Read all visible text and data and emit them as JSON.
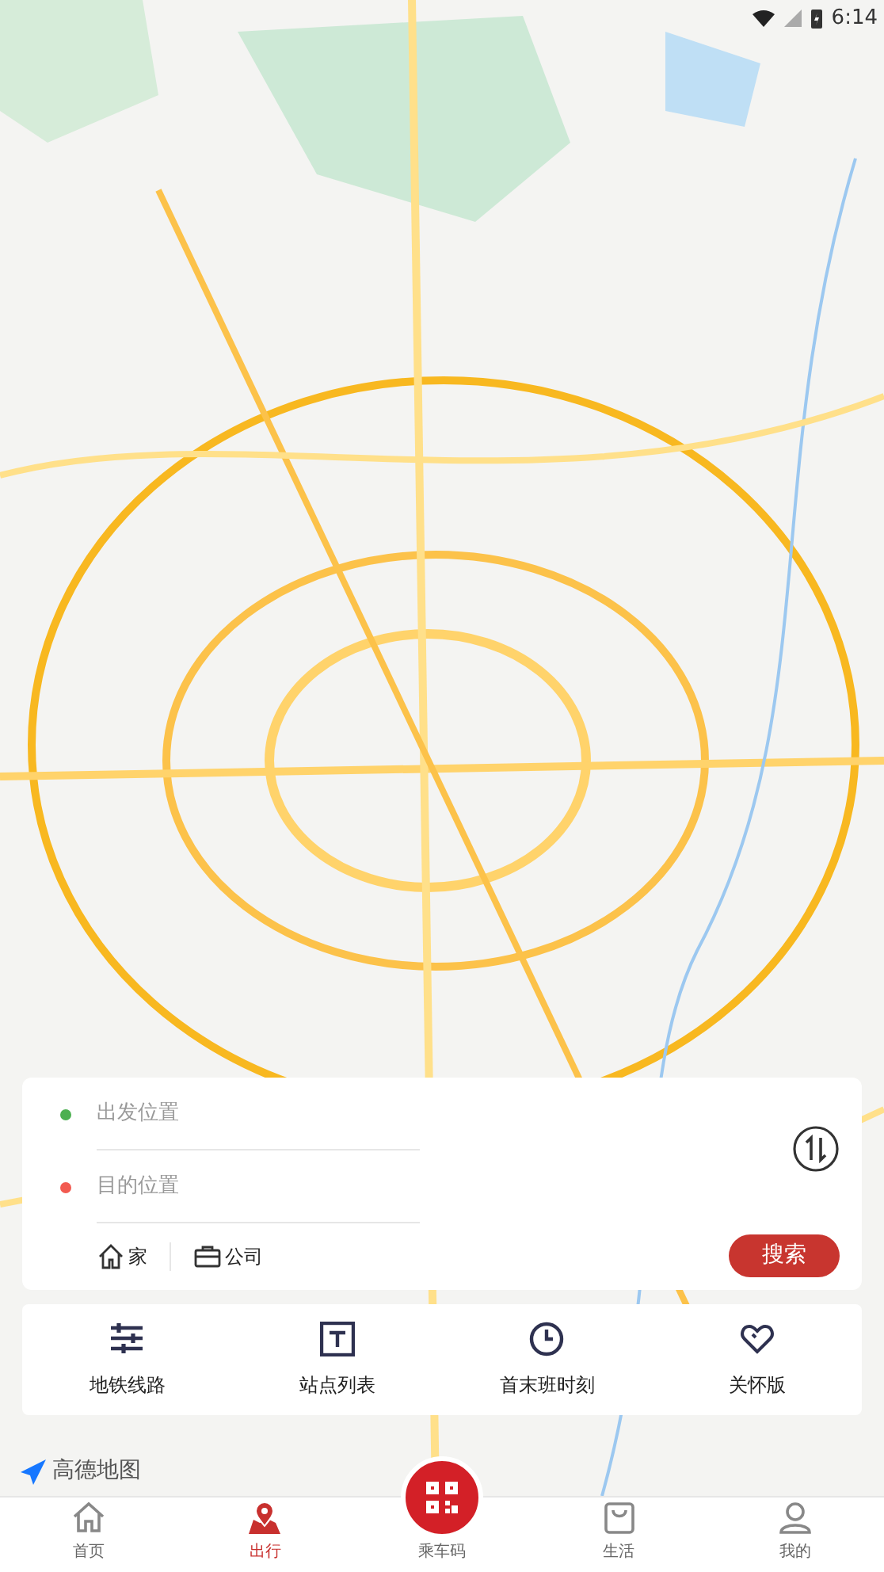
{
  "status_bar": {
    "time": "6:14"
  },
  "map": {
    "kind": "picture",
    "attribution": "高德地图"
  },
  "route_card": {
    "fields": [
      {
        "placeholder": "出发位置",
        "color": "#4cb050"
      },
      {
        "placeholder": "目的位置",
        "color": "#f25a50"
      }
    ],
    "shortcuts": [
      {
        "kind": "home",
        "label": "家"
      },
      {
        "kind": "work",
        "label": "公司"
      }
    ],
    "search_button": "搜索"
  },
  "quick_actions": [
    {
      "kind": "lines",
      "label": "地铁线路"
    },
    {
      "kind": "stations",
      "label": "站点列表"
    },
    {
      "kind": "clock",
      "label": "首末班时刻"
    },
    {
      "kind": "heart",
      "label": "关怀版"
    }
  ],
  "tab_bar": [
    {
      "kind": "home",
      "label": "首页",
      "selected": false
    },
    {
      "kind": "travel",
      "label": "出行",
      "selected": true
    },
    {
      "kind": "qr",
      "label": "乘车码",
      "selected": false
    },
    {
      "kind": "bag",
      "label": "生活",
      "selected": false
    },
    {
      "kind": "user",
      "label": "我的",
      "selected": false
    }
  ]
}
